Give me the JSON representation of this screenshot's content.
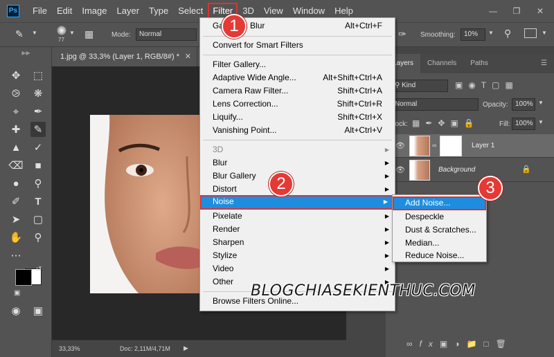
{
  "menubar": {
    "items": [
      "File",
      "Edit",
      "Image",
      "Layer",
      "Type",
      "Select",
      "Filter",
      "3D",
      "View",
      "Window",
      "Help"
    ]
  },
  "options": {
    "brush_size": "77",
    "mode_label": "Mode:",
    "mode_value": "Normal",
    "smoothing_label": "Smoothing:",
    "smoothing_value": "10%"
  },
  "document": {
    "tab_title": "1.jpg @ 33,3% (Layer 1, RGB/8#) *",
    "zoom": "33,33%",
    "doc_size": "Doc: 2,11M/4,71M"
  },
  "panels": {
    "tabs": [
      "Layers",
      "Channels",
      "Paths"
    ],
    "kind_label": "Kind",
    "blend_mode": "Normal",
    "opacity_label": "Opacity:",
    "opacity_value": "100%",
    "lock_label": "Lock:",
    "fill_label": "Fill:",
    "fill_value": "100%",
    "layers": [
      {
        "name": "Layer 1"
      },
      {
        "name": "Background"
      }
    ]
  },
  "filter_menu": {
    "items": [
      {
        "label": "Gaussian Blur",
        "shortcut": "Alt+Ctrl+F"
      },
      {
        "label": "Convert for Smart Filters"
      },
      {
        "label": "Filter Gallery..."
      },
      {
        "label": "Adaptive Wide Angle...",
        "shortcut": "Alt+Shift+Ctrl+A"
      },
      {
        "label": "Camera Raw Filter...",
        "shortcut": "Shift+Ctrl+A"
      },
      {
        "label": "Lens Correction...",
        "shortcut": "Shift+Ctrl+R"
      },
      {
        "label": "Liquify...",
        "shortcut": "Shift+Ctrl+X"
      },
      {
        "label": "Vanishing Point...",
        "shortcut": "Alt+Ctrl+V"
      },
      {
        "label": "3D"
      },
      {
        "label": "Blur"
      },
      {
        "label": "Blur Gallery"
      },
      {
        "label": "Distort"
      },
      {
        "label": "Noise"
      },
      {
        "label": "Pixelate"
      },
      {
        "label": "Render"
      },
      {
        "label": "Sharpen"
      },
      {
        "label": "Stylize"
      },
      {
        "label": "Video"
      },
      {
        "label": "Other"
      },
      {
        "label": "Browse Filters Online..."
      }
    ]
  },
  "noise_submenu": {
    "items": [
      "Add Noise...",
      "Despeckle",
      "Dust & Scratches...",
      "Median...",
      "Reduce Noise..."
    ]
  },
  "badges": [
    "1",
    "2",
    "3"
  ],
  "watermark": "BLOGCHIASEKIENTHUC.COM",
  "colors": {
    "highlight": "#1e8de0",
    "callout_red": "#e53935",
    "ui_dark": "#535353"
  }
}
